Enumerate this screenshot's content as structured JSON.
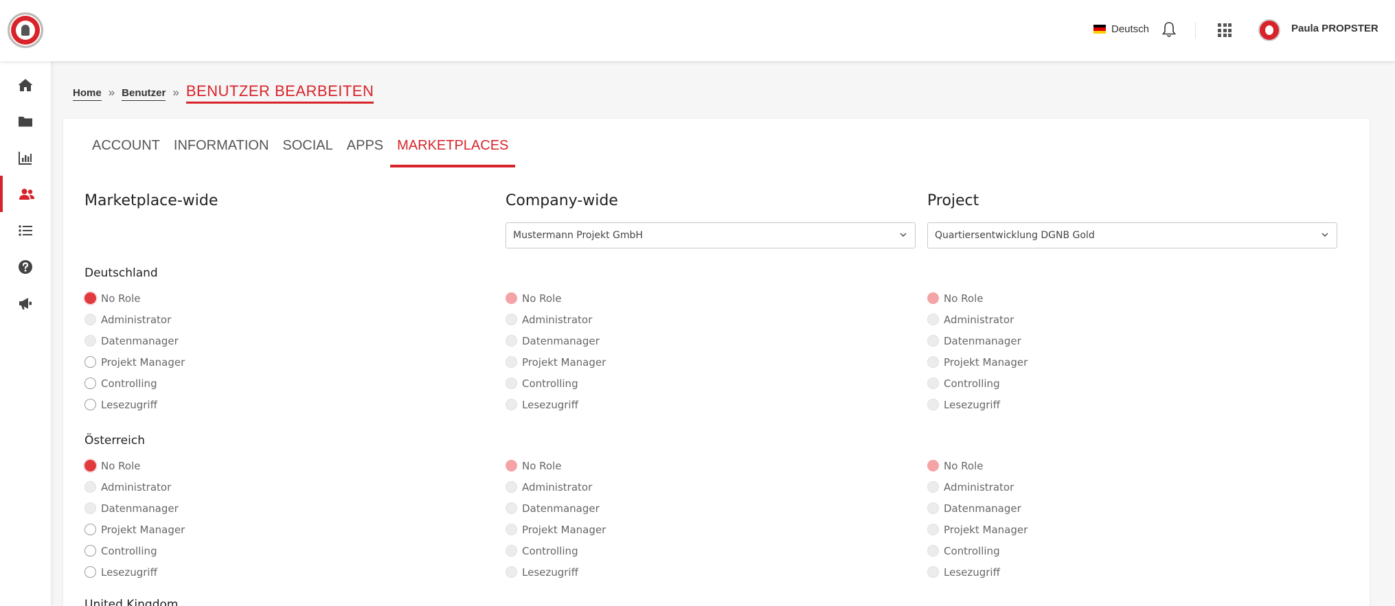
{
  "header": {
    "language": "Deutsch",
    "user_name": "Paula PROPSTER",
    "flag_colors": [
      "#000000",
      "#dd0000",
      "#ffce00"
    ]
  },
  "sidebar": {
    "items": [
      {
        "icon": "home-icon",
        "active": false
      },
      {
        "icon": "folder-icon",
        "active": false
      },
      {
        "icon": "chart-icon",
        "active": false
      },
      {
        "icon": "users-icon",
        "active": true
      },
      {
        "icon": "list-icon",
        "active": false
      },
      {
        "icon": "help-icon",
        "active": false
      },
      {
        "icon": "megaphone-icon",
        "active": false
      }
    ]
  },
  "breadcrumb": {
    "home": "Home",
    "users": "Benutzer",
    "sep": "»",
    "current": "BENUTZER BEARBEITEN"
  },
  "tabs": [
    "ACCOUNT",
    "INFORMATION",
    "SOCIAL",
    "APPS",
    "MARKETPLACES"
  ],
  "active_tab": "MARKETPLACES",
  "columns": {
    "marketplace": {
      "heading": "Marketplace-wide"
    },
    "company": {
      "heading": "Company-wide",
      "selected": "Mustermann Projekt GmbH"
    },
    "project": {
      "heading": "Project",
      "selected": "Quartiersentwicklung DGNB Gold"
    }
  },
  "roles": [
    "No Role",
    "Administrator",
    "Datenmanager",
    "Projekt Manager",
    "Controlling",
    "Lesezugriff"
  ],
  "countries": [
    {
      "name": "Deutschland"
    },
    {
      "name": "Österreich"
    }
  ],
  "next_country_partial": "United Kingdom",
  "accent_color": "#d8232a"
}
